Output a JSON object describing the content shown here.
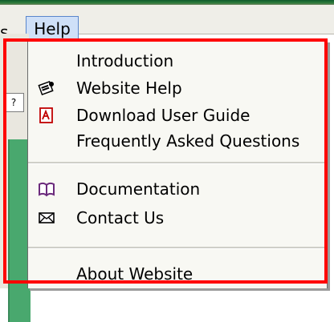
{
  "menubar": {
    "left_fragment": "s",
    "help_label": "Help"
  },
  "toolbar": {
    "icon_text": "?"
  },
  "help_menu": {
    "items": [
      {
        "label": "Introduction",
        "icon": "none"
      },
      {
        "label": "Website Help",
        "icon": "help-book-icon"
      },
      {
        "label": "Download User Guide",
        "icon": "pdf-icon"
      },
      {
        "label": "Frequently Asked Questions",
        "icon": "none"
      },
      {
        "label": "Documentation",
        "icon": "open-book-icon"
      },
      {
        "label": "Contact Us",
        "icon": "envelope-icon"
      },
      {
        "label": "About Website",
        "icon": "none"
      }
    ]
  },
  "colors": {
    "highlight_red": "#ff0000",
    "menu_highlight": "#cfe0f8",
    "green_panel": "#49a86e",
    "documentation_icon": "#6b2a7c",
    "pdf_icon": "#c00000"
  }
}
